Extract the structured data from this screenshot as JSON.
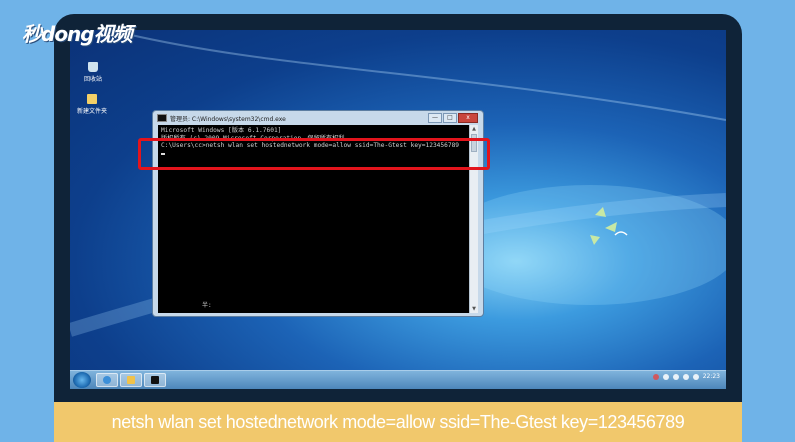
{
  "brand": {
    "logo_text": "秒dong视频"
  },
  "desktop": {
    "icons": [
      {
        "label": "回收站",
        "icon": "recycle-bin-icon"
      },
      {
        "label": "新建文件夹",
        "icon": "folder-icon"
      }
    ]
  },
  "cmd_window": {
    "title": "管理员: C:\\Windows\\system32\\cmd.exe",
    "buttons": {
      "minimize": "—",
      "maximize": "□",
      "close": "x"
    },
    "lines": [
      "Microsoft Windows [版本 6.1.7601]",
      "版权所有 (c) 2009 Microsoft Corporation。保留所有权利。",
      "",
      "C:\\Users\\cc>netsh wlan set hostednetwork mode=allow ssid=The-Gtest key=123456789"
    ],
    "ime_status": "半:"
  },
  "taskbar": {
    "clock": "22:23"
  },
  "subtitle": "netsh wlan set hostednetwork mode=allow ssid=The-Gtest key=123456789",
  "colors": {
    "highlight": "#e3141c",
    "subtitle_bg": "#f1c86c"
  }
}
